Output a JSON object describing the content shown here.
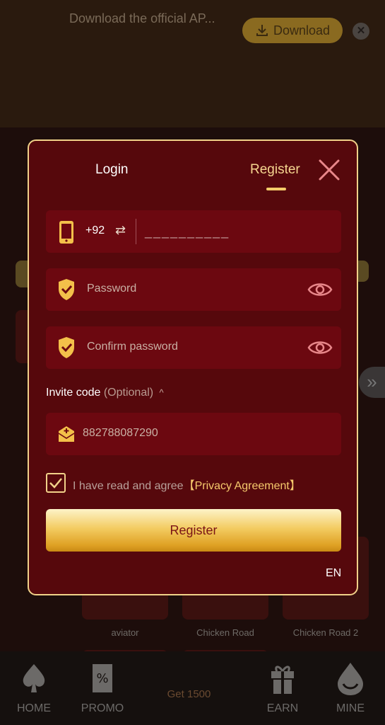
{
  "banner": {
    "text": "Download the official AP...",
    "download_label": "Download",
    "close_glyph": "✕"
  },
  "background": {
    "game_labels": [
      "aviator",
      "Chicken Road",
      "Chicken Road 2"
    ],
    "promo_text": "Get 1500",
    "nav": [
      "HOME",
      "PROMO",
      "EARN",
      "MINE"
    ],
    "side_glyph": "»"
  },
  "modal": {
    "tabs": {
      "login": "Login",
      "register": "Register",
      "active": "register"
    },
    "phone": {
      "country_code": "+92",
      "swap_glyph": "⇄",
      "placeholder": "__________"
    },
    "password": {
      "placeholder": "Password"
    },
    "confirm": {
      "placeholder": "Confirm password"
    },
    "invite": {
      "label": "Invite code",
      "optional": "(Optional)",
      "caret": "^",
      "placeholder": "882788087290"
    },
    "agree": {
      "checked": true,
      "text": "I have read and agree",
      "link": "【Privacy Agreement】"
    },
    "submit_label": "Register",
    "language": "EN"
  },
  "colors": {
    "modal_bg": "#56080c",
    "field_bg": "#6c0810",
    "gold": "#f1d189",
    "accent_text": "#f6c96c"
  }
}
